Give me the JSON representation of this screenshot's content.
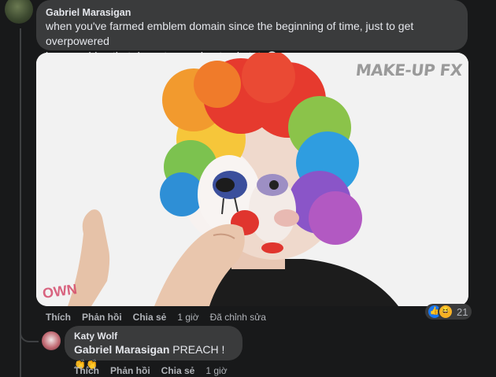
{
  "comment": {
    "author": "Gabriel Marasigan",
    "text_line1": "when you've farmed emblem domain since the beginning of time, just to get overpowered",
    "text_line2": "by em raiden that doesnt care about substats",
    "emoji": "💀",
    "media": {
      "watermark": "MAKE-UP FX",
      "channel_logo": "OWN"
    },
    "actions": {
      "like": "Thích",
      "reply": "Phản hồi",
      "share": "Chia sẻ",
      "time": "1 giờ",
      "edited": "Đã chỉnh sửa"
    },
    "reactions": {
      "like_icon": "👍",
      "haha_icon": "😆",
      "count": "21"
    }
  },
  "reply": {
    "author": "Katy Wolf",
    "mention": "Gabriel Marasigan",
    "text": " PREACH ! ",
    "emoji": "👏👏",
    "actions": {
      "like": "Thích",
      "reply": "Phản hồi",
      "share": "Chia sẻ",
      "time": "1 giờ"
    }
  }
}
